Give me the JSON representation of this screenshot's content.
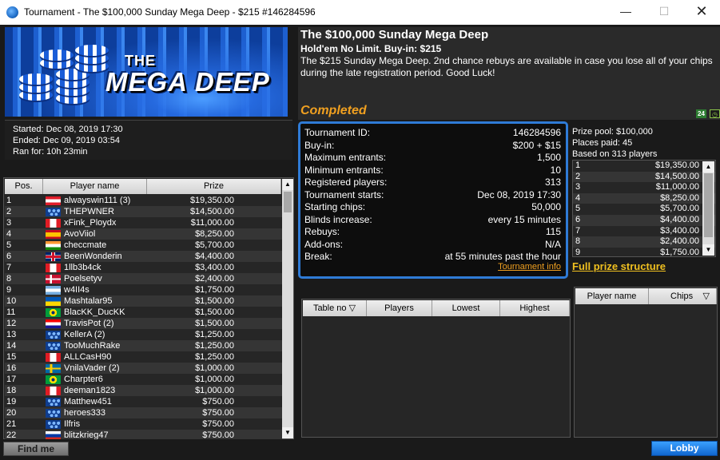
{
  "window": {
    "title": "Tournament - The $100,000 Sunday Mega Deep - $215 #146284596",
    "controls": {
      "minimize": "—",
      "maximize": "☐",
      "close": "✕"
    }
  },
  "banner": {
    "logo_the": "THE",
    "logo_main": "MEGA DEEP"
  },
  "header": {
    "name": "The $100,000 Sunday Mega Deep",
    "game": "Hold'em No Limit. Buy-in: $215",
    "description": "The $215 Sunday Mega Deep. 2nd chance rebuys are available in case you lose all of your chips during the late registration period. Good Luck!",
    "status": "Completed",
    "icons": [
      "24",
      "clock"
    ]
  },
  "times": {
    "started": "Started: Dec 08, 2019 17:30",
    "ended": "Ended: Dec 09, 2019 03:54",
    "ran_for": "Ran for: 10h 23min"
  },
  "results": {
    "columns": [
      "Pos.",
      "Player name",
      "Prize"
    ],
    "rows": [
      {
        "pos": "1",
        "flag": "AT",
        "name": "alwayswin111 (3)",
        "prize": "$19,350.00"
      },
      {
        "pos": "2",
        "flag": "PS",
        "name": "THEPWNER",
        "prize": "$14,500.00"
      },
      {
        "pos": "3",
        "flag": "CA",
        "name": "xFink_Ploydx",
        "prize": "$11,000.00"
      },
      {
        "pos": "4",
        "flag": "ES",
        "name": "AvoViiol",
        "prize": "$8,250.00"
      },
      {
        "pos": "5",
        "flag": "IN",
        "name": "checcmate",
        "prize": "$5,700.00"
      },
      {
        "pos": "6",
        "flag": "GB",
        "name": "BeenWonderin",
        "prize": "$4,400.00"
      },
      {
        "pos": "7",
        "flag": "CA",
        "name": "1llb3b4ck",
        "prize": "$3,400.00"
      },
      {
        "pos": "8",
        "flag": "DK",
        "name": "Poelsetyv",
        "prize": "$2,400.00"
      },
      {
        "pos": "9",
        "flag": "AR",
        "name": "w4II4s",
        "prize": "$1,750.00"
      },
      {
        "pos": "10",
        "flag": "UA",
        "name": "Mashtalar95",
        "prize": "$1,500.00"
      },
      {
        "pos": "11",
        "flag": "BR",
        "name": "BlacKK_DucKK",
        "prize": "$1,500.00"
      },
      {
        "pos": "12",
        "flag": "HR",
        "name": "TravisPot (2)",
        "prize": "$1,500.00"
      },
      {
        "pos": "13",
        "flag": "PS",
        "name": "KellerA (2)",
        "prize": "$1,250.00"
      },
      {
        "pos": "14",
        "flag": "PS",
        "name": "TooMuchRake",
        "prize": "$1,250.00"
      },
      {
        "pos": "15",
        "flag": "CA",
        "name": "ALLCasH90",
        "prize": "$1,250.00"
      },
      {
        "pos": "16",
        "flag": "SE",
        "name": "VnilaVader (2)",
        "prize": "$1,000.00"
      },
      {
        "pos": "17",
        "flag": "BR",
        "name": "Charpter6",
        "prize": "$1,000.00"
      },
      {
        "pos": "18",
        "flag": "CA",
        "name": "deeman1823",
        "prize": "$1,000.00"
      },
      {
        "pos": "19",
        "flag": "PS",
        "name": "Matthew451",
        "prize": "$750.00"
      },
      {
        "pos": "20",
        "flag": "PS",
        "name": "heroes333",
        "prize": "$750.00"
      },
      {
        "pos": "21",
        "flag": "PS",
        "name": "Ilfris",
        "prize": "$750.00"
      },
      {
        "pos": "22",
        "flag": "RU",
        "name": "blitzkrieg47",
        "prize": "$750.00"
      }
    ]
  },
  "info": {
    "rows": [
      {
        "label": "Tournament ID:",
        "value": "146284596"
      },
      {
        "label": "Buy-in:",
        "value": "$200 + $15"
      },
      {
        "label": "Maximum entrants:",
        "value": "1,500"
      },
      {
        "label": "Minimum entrants:",
        "value": "10"
      },
      {
        "label": "Registered players:",
        "value": "313"
      },
      {
        "label": "Tournament starts:",
        "value": "Dec 08, 2019 17:30"
      },
      {
        "label": "Starting chips:",
        "value": "50,000"
      },
      {
        "label": "Blinds increase:",
        "value": "every 15 minutes"
      },
      {
        "label": "Rebuys:",
        "value": "115"
      },
      {
        "label": "Add-ons:",
        "value": "N/A"
      },
      {
        "label": "Break:",
        "value": "at 55 minutes past the hour"
      }
    ],
    "link": "Tournament info"
  },
  "prize_pool": {
    "total": "Prize pool: $100,000",
    "places": "Places paid: 45",
    "based_on": "Based on 313 players",
    "rows": [
      {
        "place": "1",
        "amount": "$19,350.00"
      },
      {
        "place": "2",
        "amount": "$14,500.00"
      },
      {
        "place": "3",
        "amount": "$11,000.00"
      },
      {
        "place": "4",
        "amount": "$8,250.00"
      },
      {
        "place": "5",
        "amount": "$5,700.00"
      },
      {
        "place": "6",
        "amount": "$4,400.00"
      },
      {
        "place": "7",
        "amount": "$3,400.00"
      },
      {
        "place": "8",
        "amount": "$2,400.00"
      },
      {
        "place": "9",
        "amount": "$1,750.00"
      }
    ],
    "full_link": "Full prize structure"
  },
  "tables_grid": {
    "columns": [
      "Table no",
      "Players",
      "Lowest",
      "Highest"
    ]
  },
  "players_grid": {
    "columns": [
      "Player name",
      "Chips"
    ]
  },
  "buttons": {
    "find_me": "Find me",
    "lobby": "Lobby"
  },
  "colors": {
    "accent_blue": "#2f7bd6",
    "status_orange": "#f0a020",
    "link_yellow": "#f0c020",
    "lobby_blue": "#1e7ee8"
  }
}
